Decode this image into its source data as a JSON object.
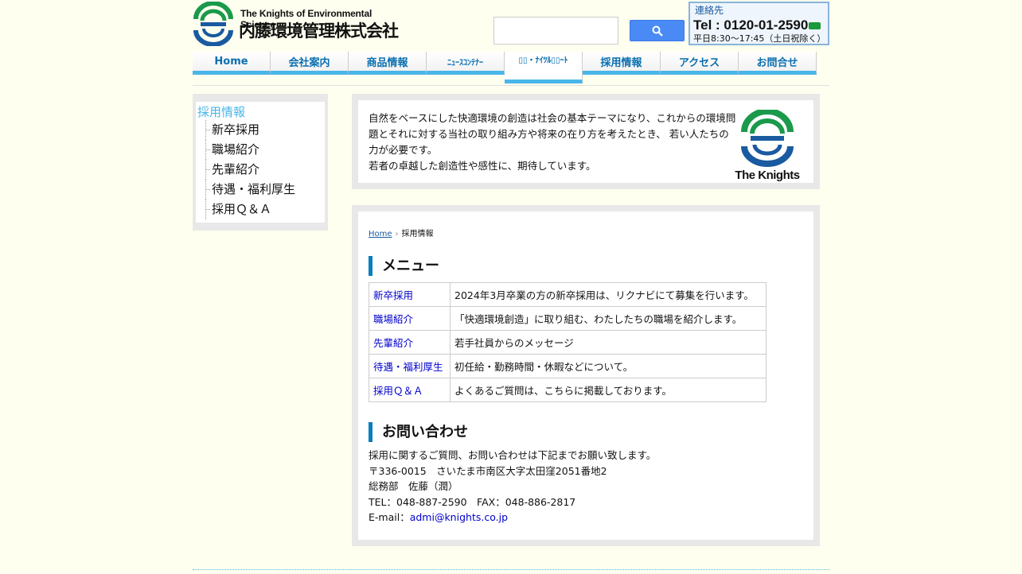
{
  "header": {
    "logo_en": "The Knights of Environmental Science",
    "logo_jp": "内藤環境管理株式会社",
    "search_placeholder": "",
    "search_icon": "magnifier-icon",
    "contact_label": "連絡先",
    "contact_tel": "Tel : 0120-01-2590",
    "contact_hours": "平日8:30～17:45（土日祝除く）"
  },
  "nav": {
    "items": [
      {
        "label": "Home"
      },
      {
        "label": "会社案内"
      },
      {
        "label": "商品情報"
      },
      {
        "label": "ﾆｭｰｽｺﾝﾃﾅｰ"
      },
      {
        "label": "▯▯・ﾅｲﾂﾙ▯▯ｰﾄ"
      },
      {
        "label": "採用情報"
      },
      {
        "label": "アクセス"
      },
      {
        "label": "お問合せ"
      }
    ]
  },
  "sidebar": {
    "title": "採用情報",
    "items": [
      "新卒採用",
      "職場紹介",
      "先輩紹介",
      "待遇・福利厚生",
      "採用Ｑ＆Ａ"
    ]
  },
  "intro": {
    "line1": "自然をベースにした快適環境の創造は社会の基本テーマになり、これからの環境問題とそれに対する当社の取り組み方や将来の在り方を考えたとき、 若い人たちの力が必要です。",
    "line2": "若者の卓越した創造性や感性に、期待しています。",
    "logo_text": "The Knights"
  },
  "breadcrumb": {
    "home": "Home",
    "current": "採用情報"
  },
  "menu": {
    "heading": "メニュー",
    "rows": [
      {
        "key": "新卒採用",
        "desc": "2024年3月卒業の方の新卒採用は、リクナビにて募集を行います。"
      },
      {
        "key": "職場紹介",
        "desc": "「快適環境創造」に取り組む、わたしたちの職場を紹介します。"
      },
      {
        "key": "先輩紹介",
        "desc": "若手社員からのメッセージ"
      },
      {
        "key": "待遇・福利厚生",
        "desc": "初任給・勤務時間・休暇などについて。"
      },
      {
        "key": "採用Ｑ＆Ａ",
        "desc": "よくあるご質問は、こちらに掲載しております。"
      }
    ]
  },
  "inquiry": {
    "heading": "お問い合わせ",
    "line1": "採用に関するご質問、お問い合わせは下記までお願い致します。",
    "line2": "〒336-0015　さいたま市南区大字太田窪2051番地2",
    "line3": "総務部　佐藤（潤）",
    "line4": "TEL：048-887-2590　FAX：048-886-2817",
    "email_label": "E-mail：",
    "email": "admi@knights.co.jp"
  },
  "colors": {
    "accent": "#49b6e8",
    "nav_text": "#0a6fb0",
    "logo_green": "#1a9a4a",
    "logo_blue": "#1a5aa0"
  }
}
